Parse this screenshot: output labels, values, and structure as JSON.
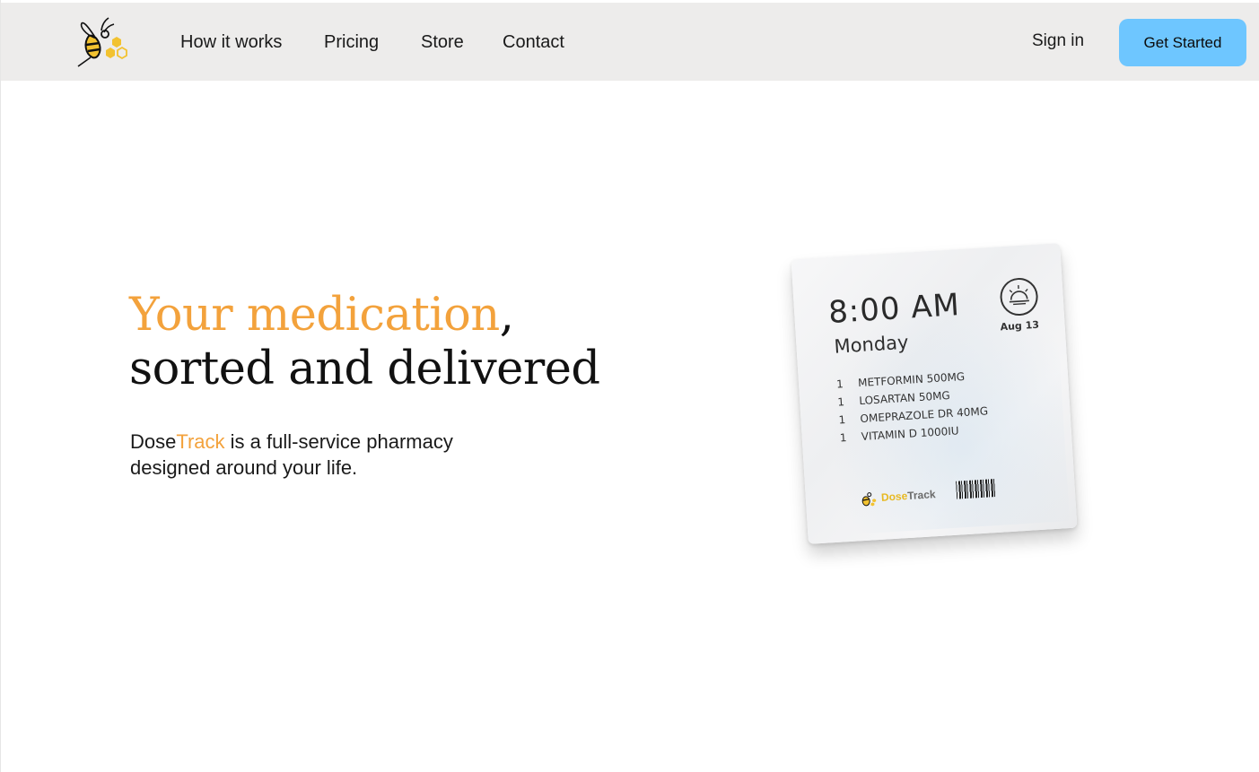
{
  "brand": {
    "logo_icon": "bee-honeycomb-logo-icon",
    "name_part1": "Dose",
    "name_part2": "Track",
    "accent_color": "#f3a23c",
    "cta_color": "#6ec6ff"
  },
  "nav": {
    "items": [
      {
        "label": "How it works"
      },
      {
        "label": "Pricing"
      },
      {
        "label": "Store"
      },
      {
        "label": "Contact"
      }
    ],
    "sign_in": "Sign in",
    "cta": "Get Started"
  },
  "hero": {
    "title_accent": "Your medication",
    "title_comma": ",",
    "title_line2": "sorted and delivered",
    "subtitle_brand1": "Dose",
    "subtitle_brand2": "Track",
    "subtitle_rest_line1": " is a full-service pharmacy",
    "subtitle_rest_line2": "designed around your life."
  },
  "packet": {
    "time": "8:00 AM",
    "day": "Monday",
    "date": "Aug 13",
    "icon": "sunrise-icon",
    "medications": [
      {
        "qty": "1",
        "name": "METFORMIN 500MG"
      },
      {
        "qty": "1",
        "name": "LOSARTAN  50MG"
      },
      {
        "qty": "1",
        "name": "OMEPRAZOLE DR 40MG"
      },
      {
        "qty": "1",
        "name": "VITAMIN D 1000IU"
      }
    ],
    "brand1": "Dose",
    "brand2": "Track"
  }
}
